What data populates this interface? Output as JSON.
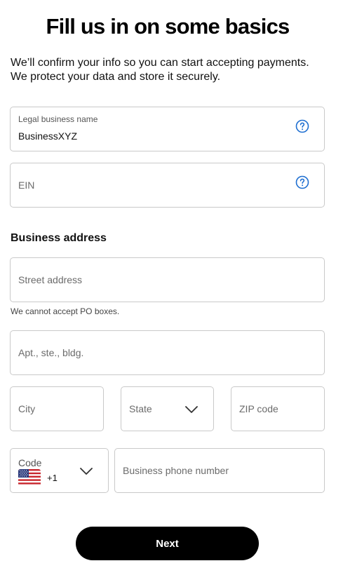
{
  "header": {
    "title": "Fill us in on some basics",
    "subtitle_line1": "We’ll confirm your info so you can start accepting payments.",
    "subtitle_line2": "We protect your data and store it securely."
  },
  "business": {
    "legal_name_label": "Legal business name",
    "legal_name_value": "BusinessXYZ",
    "ein_placeholder": "EIN",
    "help_icon": "question-circle-icon"
  },
  "address": {
    "section_title": "Business address",
    "street_placeholder": "Street address",
    "po_hint": "We cannot accept PO boxes.",
    "apt_placeholder": "Apt., ste., bldg.",
    "city_placeholder": "City",
    "state_placeholder": "State",
    "zip_placeholder": "ZIP code"
  },
  "phone": {
    "code_label": "Code",
    "dial_code": "+1",
    "flag_icon": "us-flag-icon",
    "phone_placeholder": "Business phone number"
  },
  "actions": {
    "next_label": "Next"
  },
  "colors": {
    "accent": "#1f6fd1",
    "border": "#c9c9c9",
    "button": "#000000"
  }
}
